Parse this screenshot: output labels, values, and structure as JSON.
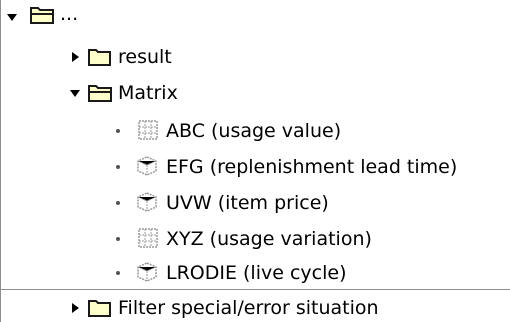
{
  "tree": {
    "root": {
      "label": "...",
      "expanded": true,
      "icon": "folder-open-icon"
    },
    "children": [
      {
        "label": "result",
        "expanded": false,
        "icon": "folder-closed-icon"
      },
      {
        "label": "Matrix",
        "expanded": true,
        "icon": "folder-open-icon",
        "items": [
          {
            "label": "ABC (usage value)",
            "icon": "grid-matrix-icon"
          },
          {
            "label": "EFG (replenishment lead time)",
            "icon": "cube-matrix-icon"
          },
          {
            "label": "UVW (item price)",
            "icon": "cube-matrix-icon"
          },
          {
            "label": "XYZ (usage variation)",
            "icon": "grid-matrix-icon"
          },
          {
            "label": "LRODIE (live cycle)",
            "icon": "cube-matrix-icon"
          }
        ]
      },
      {
        "label": "Filter special/error situation",
        "expanded": false,
        "icon": "folder-closed-icon"
      }
    ]
  },
  "colors": {
    "folder_fill": "#ffffcc",
    "folder_stroke": "#1a1a1a",
    "border": "#8f8f8f",
    "item_icon_stroke": "#9a9a9a"
  }
}
